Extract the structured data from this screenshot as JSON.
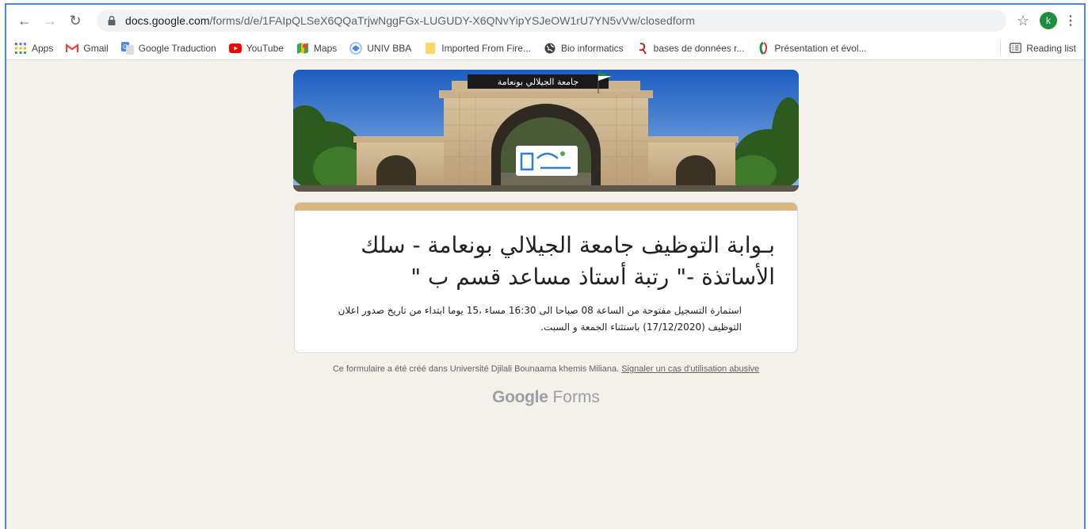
{
  "browser": {
    "url_host": "docs.google.com",
    "url_path": "/forms/d/e/1FAIpQLSeX6QQaTrjwNggFGx-LUGUDY-X6QNvYipYSJeOW1rU7YN5vVw/closedform",
    "profile_initial": "k",
    "icons": [
      "back-icon",
      "forward-icon",
      "reload-icon",
      "lock-icon",
      "star-icon",
      "menu-icon"
    ]
  },
  "bookmarks": {
    "items": [
      {
        "label": "Apps",
        "icon": "apps-icon"
      },
      {
        "label": "Gmail",
        "icon": "gmail-icon"
      },
      {
        "label": "Google Traduction",
        "icon": "translate-icon"
      },
      {
        "label": "YouTube",
        "icon": "youtube-icon"
      },
      {
        "label": "Maps",
        "icon": "maps-icon"
      },
      {
        "label": "UNIV BBA",
        "icon": "univ-icon"
      },
      {
        "label": "Imported From Fire...",
        "icon": "folder-icon"
      },
      {
        "label": "Bio informatics",
        "icon": "globe-icon"
      },
      {
        "label": "bases de données r...",
        "icon": "site-icon"
      },
      {
        "label": "Présentation et évol...",
        "icon": "site-icon"
      }
    ],
    "reading_list": "Reading list"
  },
  "form": {
    "header_sign_text": "جامعة الجيلالي بونعامة",
    "title": "بـوابة التوظيف جامعة الجيلالي بونعامة - سلك الأساتذة -\" رتبة أستاذ مساعد قسم ب \"",
    "description": "استمارة التسجيل مفتوحة من الساعة 08 صباحا الى 16:30 مساء ،15 يوما ابتداء من تاريخ صدور اعلان التوظيف (17/12/2020) باستثناء الجمعة و السبت.",
    "accent_color": "#d9b77e"
  },
  "footer": {
    "created_text": "Ce formulaire a été créé dans Université Djilali Bounaama khemis Miliana.",
    "report_link": "Signaler un cas d'utilisation abusive",
    "brand_google": "Google",
    "brand_forms": "Forms"
  }
}
